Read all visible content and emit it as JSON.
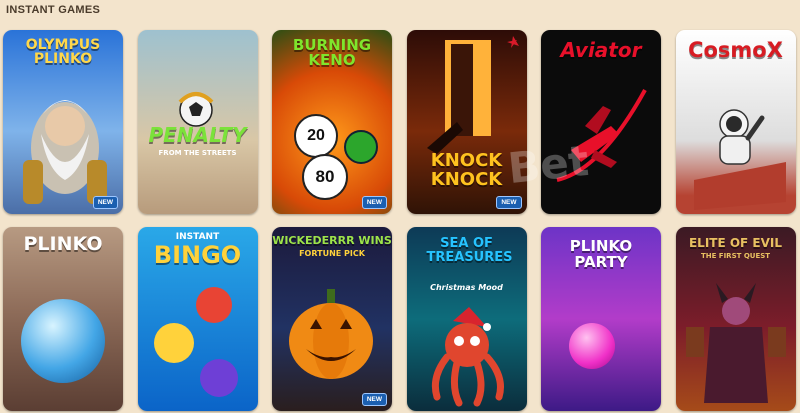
{
  "section": {
    "title": "INSTANT GAMES"
  },
  "badge_new": "NEW",
  "watermark": "Bet",
  "games": [
    {
      "title": "OLYMPUS PLINKO",
      "subtitle": "",
      "badge": "NEW"
    },
    {
      "title": "PENALTY",
      "subtitle": "FROM THE STREETS",
      "badge": ""
    },
    {
      "title": "BURNING KENO",
      "subtitle": "",
      "badge": "NEW",
      "balls": [
        "20",
        "80"
      ]
    },
    {
      "title": "KNOCK KNOCK",
      "subtitle": "",
      "badge": "NEW"
    },
    {
      "title": "Aviator",
      "subtitle": "",
      "badge": ""
    },
    {
      "title": "CosmoX",
      "subtitle": "",
      "badge": ""
    },
    {
      "title": "PLINKO",
      "subtitle": "",
      "badge": ""
    },
    {
      "title": "BINGO",
      "subtitle": "INSTANT",
      "badge": ""
    },
    {
      "title": "WICKEDERRR WINS",
      "subtitle": "FORTUNE PICK",
      "badge": "NEW"
    },
    {
      "title": "SEA OF TREASURES",
      "subtitle": "Christmas Mood",
      "badge": ""
    },
    {
      "title": "PLINKO PARTY",
      "subtitle": "",
      "badge": ""
    },
    {
      "title": "ELITE OF EVIL",
      "subtitle": "THE FIRST QUEST",
      "badge": ""
    }
  ]
}
